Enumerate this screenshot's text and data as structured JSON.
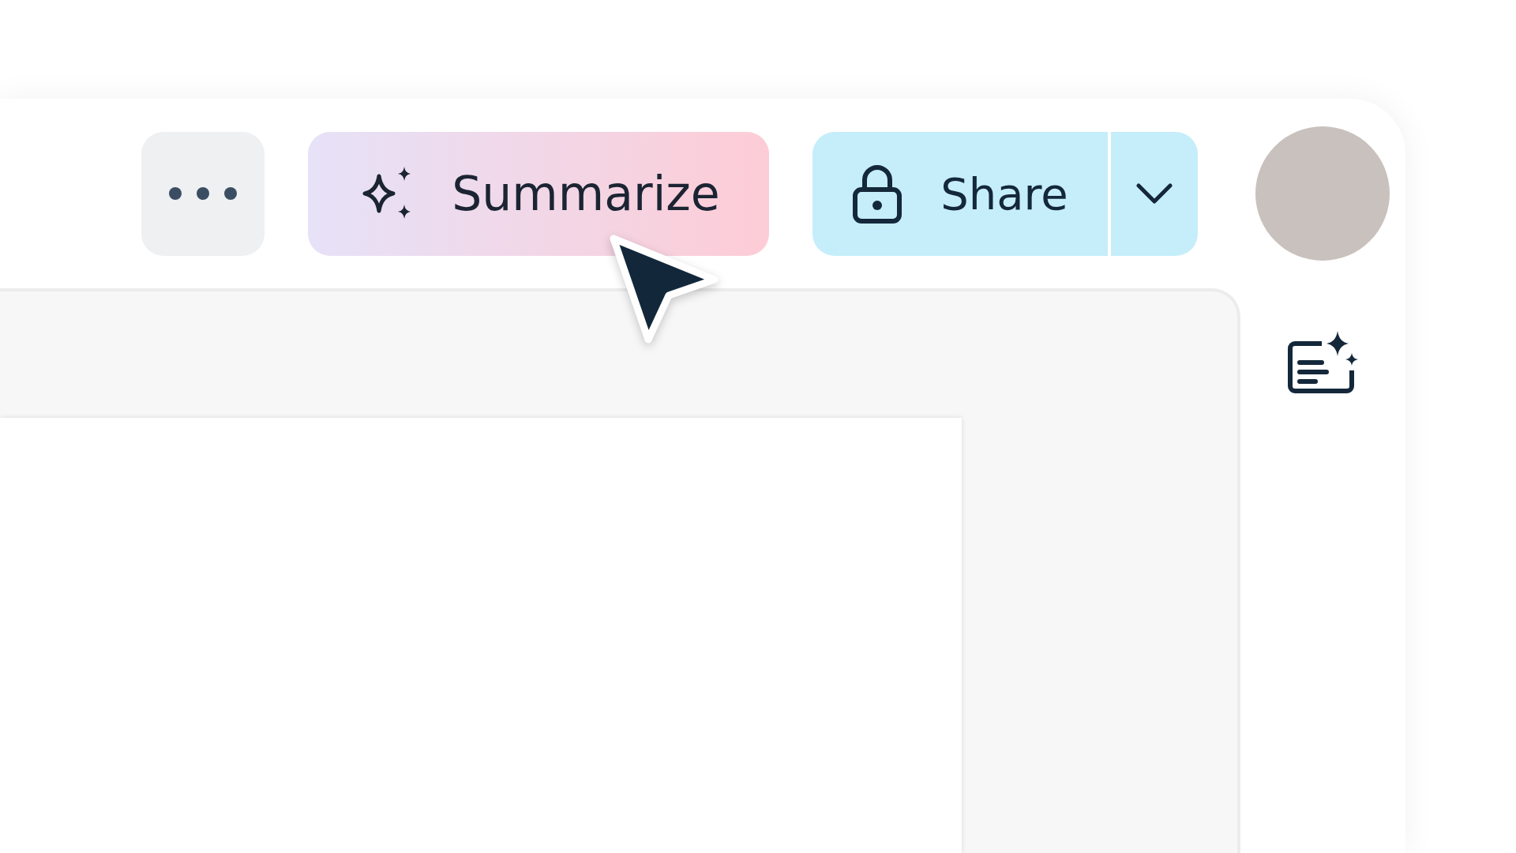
{
  "toolbar": {
    "summarize_button": {
      "label": "Summarize"
    },
    "share_button": {
      "label": "Share"
    }
  }
}
